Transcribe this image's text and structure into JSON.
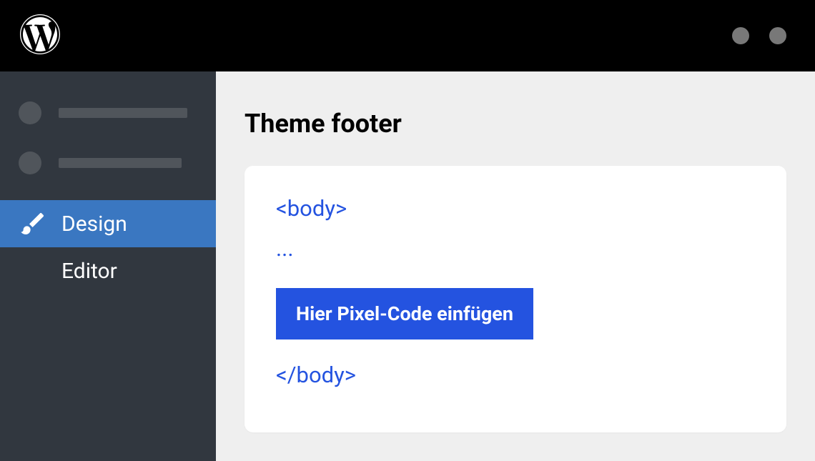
{
  "sidebar": {
    "design_label": "Design",
    "editor_label": "Editor"
  },
  "main": {
    "title": "Theme footer",
    "code": {
      "open_tag": "<body>",
      "ellipsis": "...",
      "insert_label": "Hier Pixel-Code einfügen",
      "close_tag": "</body>"
    }
  }
}
